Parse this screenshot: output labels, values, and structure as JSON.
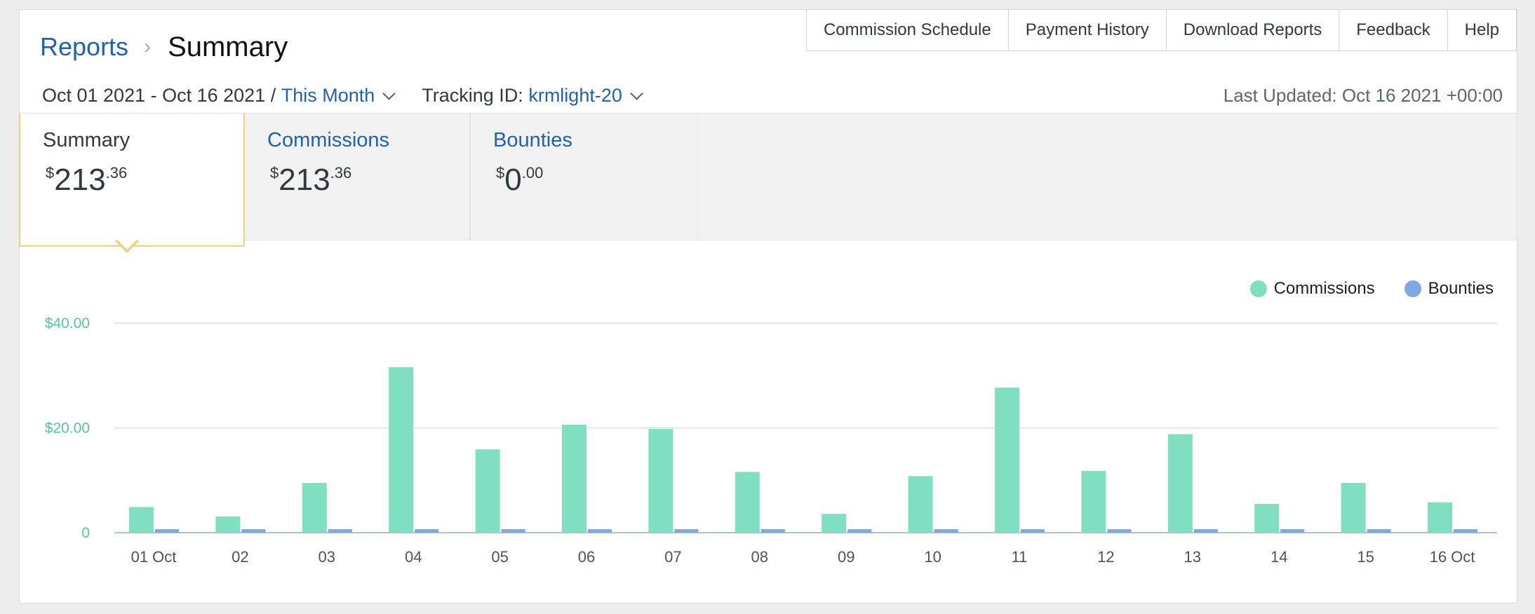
{
  "breadcrumb": {
    "root": "Reports",
    "separator": "›",
    "current": "Summary"
  },
  "top_nav": [
    "Commission Schedule",
    "Payment History",
    "Download Reports",
    "Feedback",
    "Help"
  ],
  "filters": {
    "date_range": "Oct 01 2021 - Oct 16 2021",
    "separator": " / ",
    "period": "This Month",
    "tracking_label": "Tracking ID: ",
    "tracking_id": "krmlight-20"
  },
  "last_updated": "Last Updated: Oct 16 2021 +00:00",
  "tabs": [
    {
      "title": "Summary",
      "currency": "$",
      "whole": "213",
      "cents": ".36"
    },
    {
      "title": "Commissions",
      "currency": "$",
      "whole": "213",
      "cents": ".36"
    },
    {
      "title": "Bounties",
      "currency": "$",
      "whole": "0",
      "cents": ".00"
    }
  ],
  "colors": {
    "commissions": "#80dfc1",
    "bounties": "#7fa7e0",
    "accent": "#1e62b0",
    "active_tab_border": "#f2cf7d"
  },
  "chart_data": {
    "type": "bar",
    "categories": [
      "01 Oct",
      "02",
      "03",
      "04",
      "05",
      "06",
      "07",
      "08",
      "09",
      "10",
      "11",
      "12",
      "13",
      "14",
      "15",
      "16 Oct"
    ],
    "series": [
      {
        "name": "Commissions",
        "values": [
          4.9,
          3.1,
          9.5,
          31.6,
          15.9,
          20.6,
          19.8,
          11.6,
          3.6,
          10.8,
          27.7,
          11.8,
          18.8,
          5.5,
          9.5,
          5.8
        ]
      },
      {
        "name": "Bounties",
        "values": [
          0,
          0,
          0,
          0,
          0,
          0,
          0,
          0,
          0,
          0,
          0,
          0,
          0,
          0,
          0,
          0
        ]
      }
    ],
    "y_ticks": [
      "0",
      "$20.00",
      "$40.00"
    ],
    "y_tick_values": [
      0,
      20,
      40
    ],
    "ylim": [
      0,
      40
    ],
    "grid": true,
    "legend": "top-right"
  }
}
